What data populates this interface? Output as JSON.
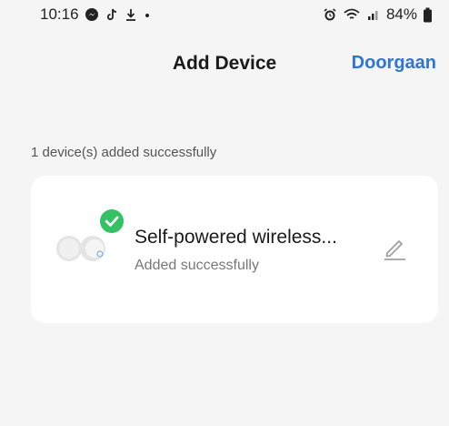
{
  "status_bar": {
    "time": "10:16",
    "left_icons": [
      "messenger-icon",
      "tiktok-icon",
      "download-icon",
      "dot-icon"
    ],
    "right_icons": [
      "alarm-icon",
      "wifi-icon",
      "signal-icon",
      "battery-icon"
    ],
    "battery": "84%"
  },
  "header": {
    "title": "Add Device",
    "continue_label": "Doorgaan"
  },
  "summary": "1 device(s) added successfully",
  "device": {
    "name": "Self-powered wireless...",
    "status": "Added successfully",
    "icons": [
      "device-image",
      "success-check-icon",
      "edit-icon"
    ]
  },
  "colors": {
    "accent": "#2f74d9",
    "success": "#33c163",
    "background": "#f5f5f5",
    "card": "#ffffff"
  }
}
